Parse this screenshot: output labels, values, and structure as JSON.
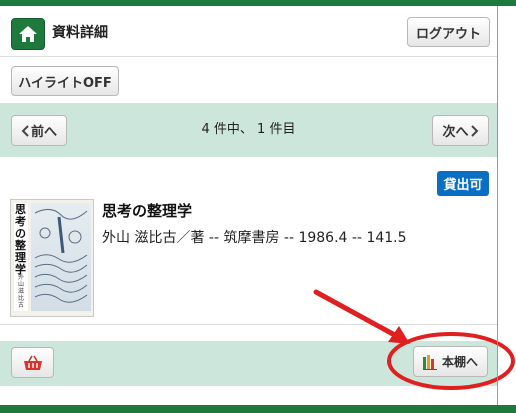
{
  "header": {
    "title": "資料詳細",
    "logout_label": "ログアウト"
  },
  "toolbar": {
    "highlight_label": "ハイライトOFF"
  },
  "pager": {
    "prev_label": "前へ",
    "next_label": "次へ",
    "position_text": "4 件中、 1 件目"
  },
  "record": {
    "status_badge": "貸出可",
    "title": "思考の整理学",
    "meta": "外山 滋比古／著 -- 筑摩書房 -- 1986.4 -- 141.5",
    "cover_title": "思考の整理学",
    "cover_author": "外山滋比古"
  },
  "footer": {
    "shelf_label": "本棚へ"
  },
  "colors": {
    "brand": "#1e7a3c",
    "band": "#cde6dc",
    "badge": "#0a6fc2",
    "annotation": "#e02020"
  },
  "icons": {
    "home": "home-icon",
    "basket": "basket-icon",
    "shelf": "bookshelf-icon",
    "prev": "chevron-left-icon",
    "next": "chevron-right-icon"
  }
}
